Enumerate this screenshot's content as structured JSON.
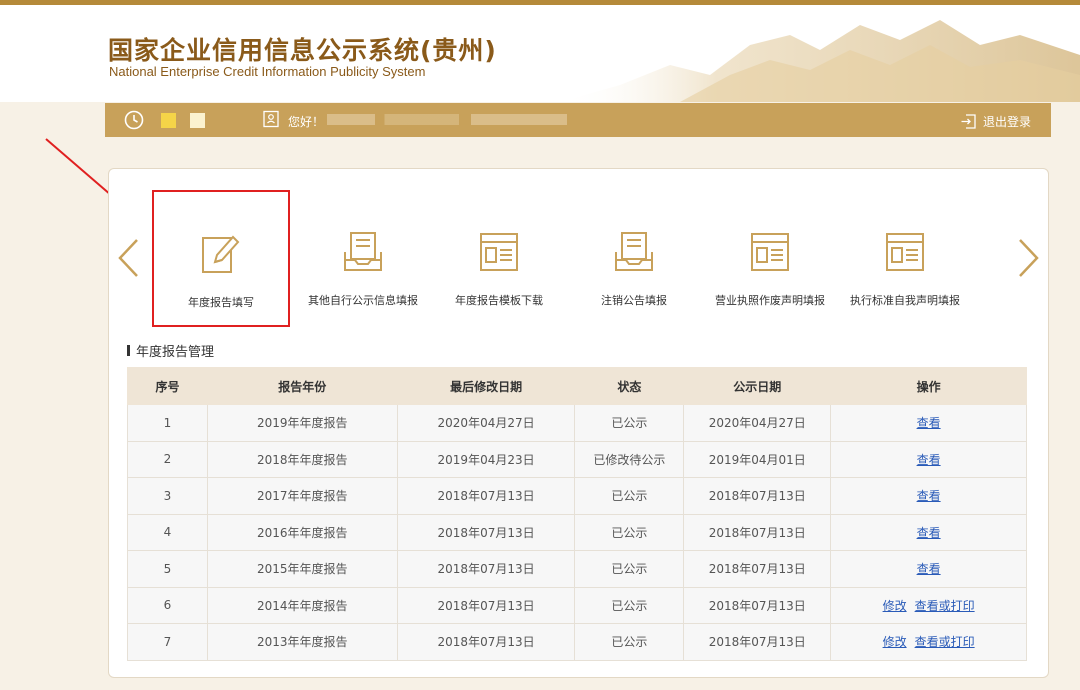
{
  "header": {
    "title": "国家企业信用信息公示系统(贵州)",
    "subtitle": "National Enterprise Credit Information Publicity System"
  },
  "userbar": {
    "greeting": "您好！",
    "logout_label": "退出登录"
  },
  "tiles": [
    {
      "label": "年度报告填写",
      "icon": "edit-document-icon"
    },
    {
      "label": "其他自行公示信息填报",
      "icon": "inbox-document-icon"
    },
    {
      "label": "年度报告模板下载",
      "icon": "form-template-icon"
    },
    {
      "label": "注销公告填报",
      "icon": "inbox-document-icon"
    },
    {
      "label": "营业执照作废声明填报",
      "icon": "form-template-icon"
    },
    {
      "label": "执行标准自我声明填报",
      "icon": "form-template-icon"
    }
  ],
  "section": {
    "title": "年度报告管理"
  },
  "table": {
    "headers": [
      "序号",
      "报告年份",
      "最后修改日期",
      "状态",
      "公示日期",
      "操作"
    ],
    "rows": [
      {
        "no": "1",
        "year": "2019年年度报告",
        "modified": "2020年04月27日",
        "status": "已公示",
        "published": "2020年04月27日",
        "actions": [
          "查看"
        ]
      },
      {
        "no": "2",
        "year": "2018年年度报告",
        "modified": "2019年04月23日",
        "status": "已修改待公示",
        "published": "2019年04月01日",
        "actions": [
          "查看"
        ]
      },
      {
        "no": "3",
        "year": "2017年年度报告",
        "modified": "2018年07月13日",
        "status": "已公示",
        "published": "2018年07月13日",
        "actions": [
          "查看"
        ]
      },
      {
        "no": "4",
        "year": "2016年年度报告",
        "modified": "2018年07月13日",
        "status": "已公示",
        "published": "2018年07月13日",
        "actions": [
          "查看"
        ]
      },
      {
        "no": "5",
        "year": "2015年年度报告",
        "modified": "2018年07月13日",
        "status": "已公示",
        "published": "2018年07月13日",
        "actions": [
          "查看"
        ]
      },
      {
        "no": "6",
        "year": "2014年年度报告",
        "modified": "2018年07月13日",
        "status": "已公示",
        "published": "2018年07月13日",
        "actions": [
          "修改",
          "查看或打印"
        ]
      },
      {
        "no": "7",
        "year": "2013年年度报告",
        "modified": "2018年07月13日",
        "status": "已公示",
        "published": "2018年07月13日",
        "actions": [
          "修改",
          "查看或打印"
        ]
      }
    ]
  },
  "colors": {
    "brand_gold": "#c8a15a",
    "title_brown": "#8a5a1a",
    "highlight_red": "#e02020",
    "link_blue": "#2a5bb8"
  }
}
